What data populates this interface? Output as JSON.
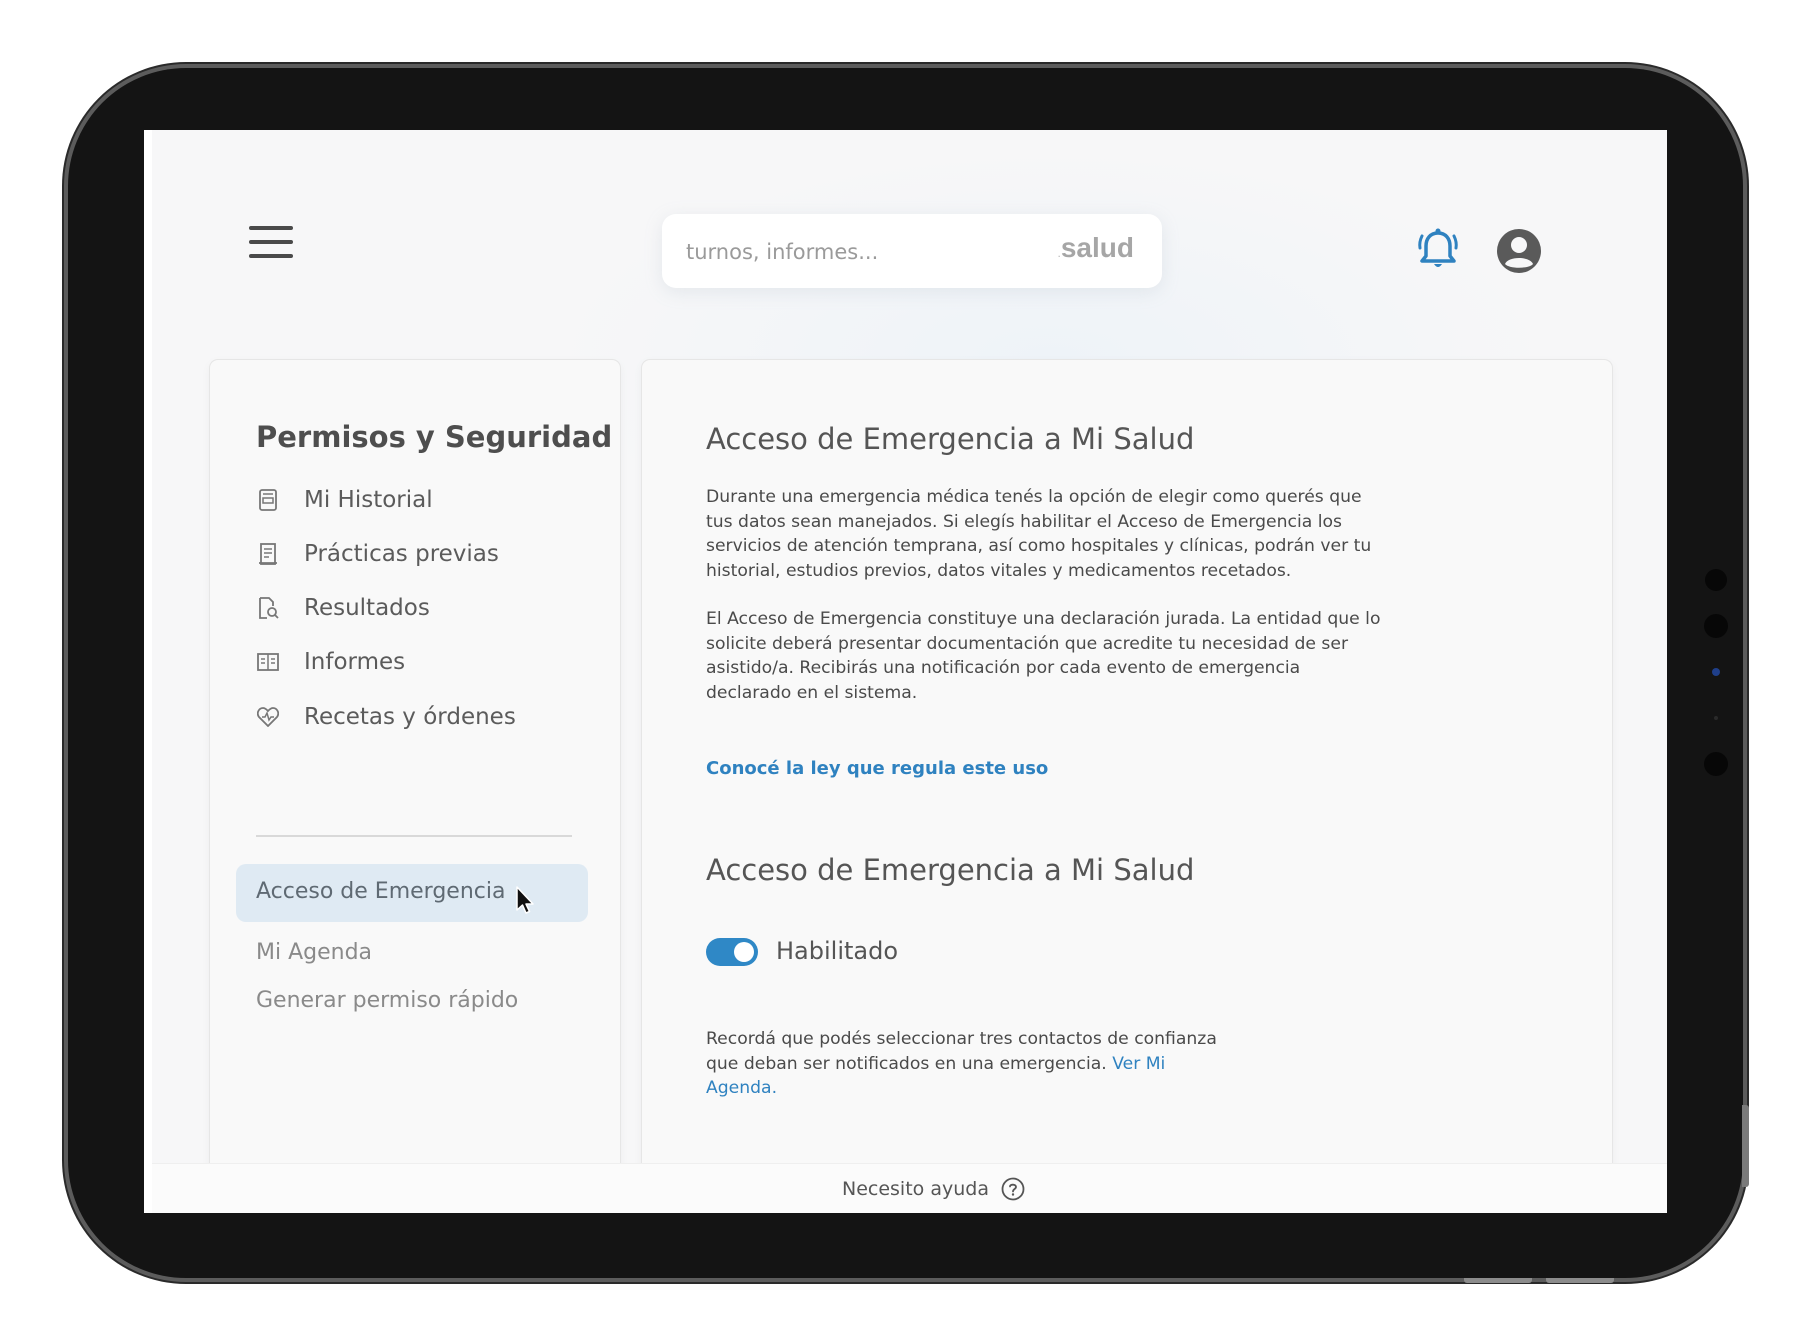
{
  "header": {
    "search_placeholder": "turnos, informes...",
    "brand_prefix": ".",
    "brand": "salud"
  },
  "sidebar": {
    "title": "Permisos y Seguridad",
    "items": [
      {
        "label": "Mi Historial",
        "icon": "history-document-icon"
      },
      {
        "label": "Prácticas previas",
        "icon": "clipboard-list-icon"
      },
      {
        "label": "Resultados",
        "icon": "document-search-icon"
      },
      {
        "label": "Informes",
        "icon": "report-grid-icon"
      },
      {
        "label": "Recetas y órdenes",
        "icon": "heart-pulse-icon"
      }
    ],
    "secondary": {
      "selected": "Acceso de Emergencia",
      "agenda": "Mi Agenda",
      "quick": "Generar permiso rápido"
    }
  },
  "main": {
    "section1": {
      "title": "Acceso de Emergencia a Mi Salud",
      "p1": "Durante una emergencia médica tenés la opción de elegir como querés que tus datos sean manejados. Si elegís habilitar el Acceso de Emergencia los servicios de atención temprana, así como hospitales y clínicas, podrán ver tu historial, estudios previos, datos vitales y medicamentos recetados.",
      "p2": "El Acceso de Emergencia constituye una declaración jurada. La entidad que lo solicite deberá presentar documentación que acredite tu necesidad de ser asistido/a. Recibirás una notificación por cada evento de emergencia declarado en el sistema.",
      "law_link": "Conocé la ley que regula este uso"
    },
    "section2": {
      "title": "Acceso de Emergencia a Mi Salud",
      "toggle_label": "Habilitado",
      "toggle_on": true,
      "note": "Recordá que podés seleccionar tres contactos de confianza que deban ser notificados en una emergencia.",
      "note_link": "Ver Mi Agenda."
    }
  },
  "footer": {
    "help": "Necesito ayuda"
  },
  "colors": {
    "accent": "#2f82c0",
    "toggle": "#2f88c6",
    "selected_bg": "#dfeaf3"
  }
}
